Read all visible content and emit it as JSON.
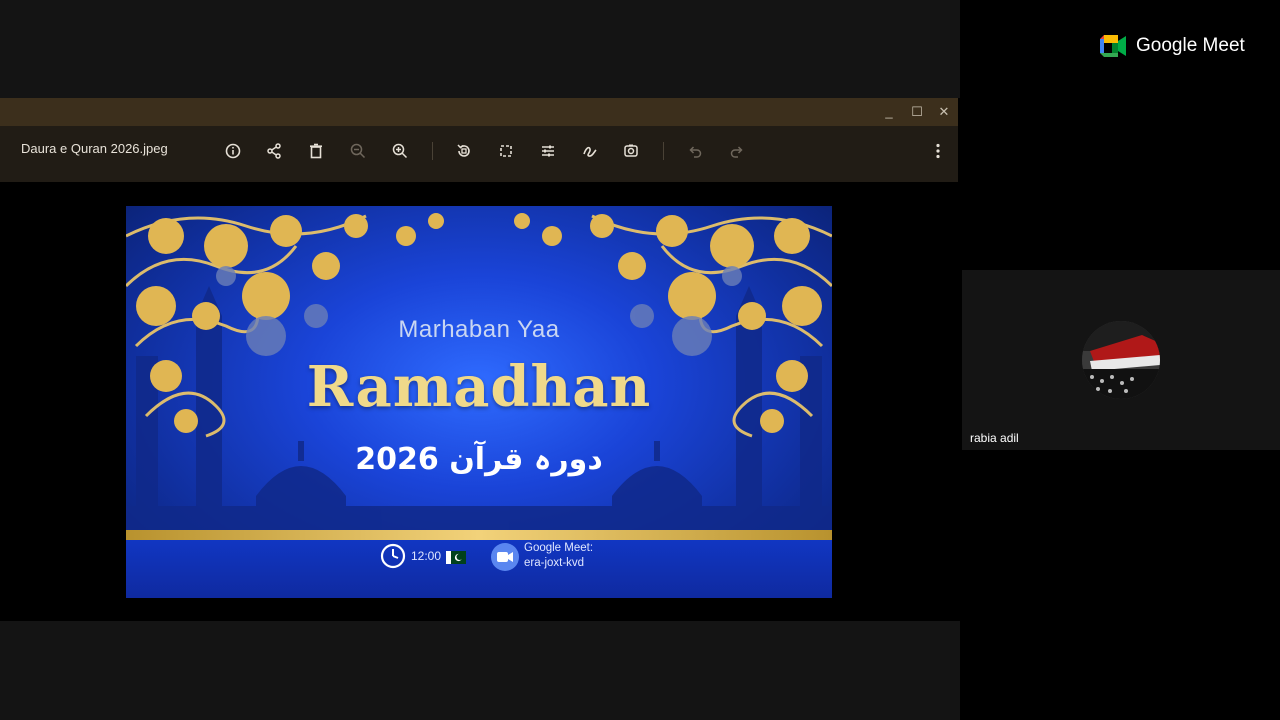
{
  "viewer": {
    "file_name": "Daura e Quran 2026.jpeg",
    "window_controls": {
      "minimize": "_",
      "maximize": "☐",
      "close": "✕"
    }
  },
  "poster": {
    "subtitle": "Marhaban Yaa",
    "title": "Ramadhan",
    "urdu_line": "دورہ قرآن 2026",
    "time": "12:00",
    "meet_label": "Google Meet:",
    "meet_code": "era-joxt-kvd"
  },
  "meet": {
    "brand": "Google Meet",
    "participant": {
      "name": "rabia adil"
    }
  },
  "icons": {
    "toolbar": [
      "info-icon",
      "share-icon",
      "delete-icon",
      "zoom-out-icon",
      "zoom-in-icon",
      "rotate-icon",
      "crop-icon",
      "adjust-icon",
      "markup-icon",
      "lens-icon",
      "undo-icon",
      "redo-icon",
      "more-icon"
    ]
  },
  "colors": {
    "toolbar_bg": "#211c15",
    "titlebar_bg": "#3c2f1c",
    "poster_blue": "#1a44d8",
    "poster_gold": "#f0d98a"
  }
}
